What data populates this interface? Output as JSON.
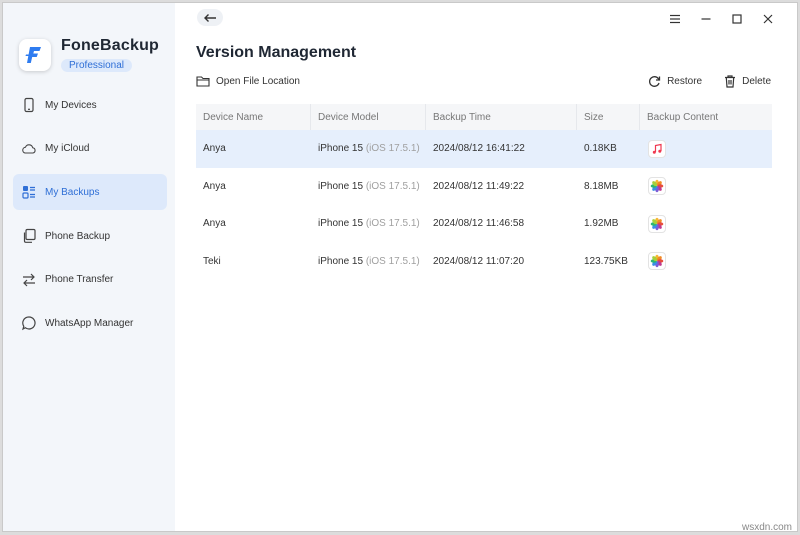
{
  "app": {
    "name": "FoneBackup",
    "edition": "Professional"
  },
  "sidebar": {
    "items": [
      {
        "label": "My Devices",
        "icon": "phone-icon"
      },
      {
        "label": "My iCloud",
        "icon": "cloud-icon"
      },
      {
        "label": "My Backups",
        "icon": "backups-icon",
        "active": true
      },
      {
        "label": "Phone Backup",
        "icon": "copy-icon"
      },
      {
        "label": "Phone Transfer",
        "icon": "transfer-icon"
      },
      {
        "label": "WhatsApp Manager",
        "icon": "chat-icon"
      }
    ]
  },
  "main": {
    "title": "Version Management",
    "open_location": "Open File Location",
    "restore": "Restore",
    "delete": "Delete"
  },
  "table": {
    "headers": [
      "Device Name",
      "Device Model",
      "Backup Time",
      "Size",
      "Backup Content"
    ],
    "rows": [
      {
        "name": "Anya",
        "model": "iPhone 15",
        "ios": "(iOS 17.5.1)",
        "time": "2024/08/12 16:41:22",
        "size": "0.18KB",
        "content": "music-icon",
        "selected": true
      },
      {
        "name": "Anya",
        "model": "iPhone 15",
        "ios": "(iOS 17.5.1)",
        "time": "2024/08/12 11:49:22",
        "size": "8.18MB",
        "content": "photos-icon"
      },
      {
        "name": "Anya",
        "model": "iPhone 15",
        "ios": "(iOS 17.5.1)",
        "time": "2024/08/12 11:46:58",
        "size": "1.92MB",
        "content": "photos-icon"
      },
      {
        "name": "Teki",
        "model": "iPhone 15",
        "ios": "(iOS 17.5.1)",
        "time": "2024/08/12 11:07:20",
        "size": "123.75KB",
        "content": "photos-icon"
      }
    ]
  },
  "watermark": "wsxdn.com",
  "colors": {
    "accent": "#2f6fd6",
    "sidebar_bg": "#f3f6fa",
    "active_bg": "#dde9fb",
    "selected_row": "#e6effc"
  }
}
